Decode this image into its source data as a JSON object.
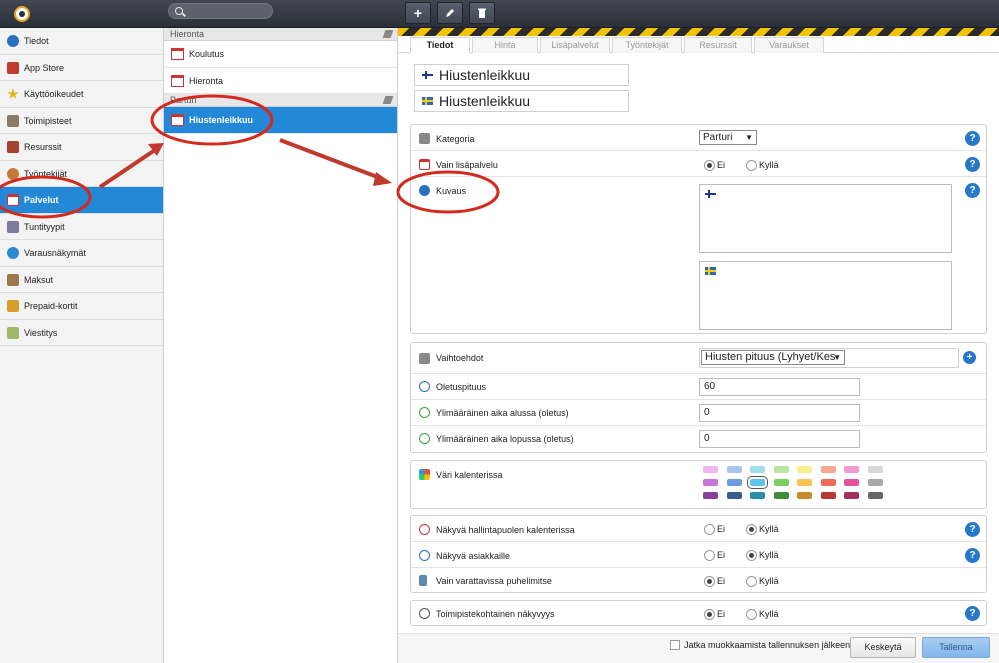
{
  "topbar": {
    "search_placeholder": "",
    "add_label": "+",
    "edit_icon": "pencil-icon",
    "delete_icon": "trash-icon"
  },
  "sidebar": {
    "items": [
      {
        "label": "Tiedot",
        "icon": "info-icon",
        "color": "#2a6fc2"
      },
      {
        "label": "App Store",
        "icon": "store-icon",
        "color": "#c43a2e"
      },
      {
        "label": "Käyttöoikeudet",
        "icon": "star-icon",
        "color": "#e3b81c"
      },
      {
        "label": "Toimipisteet",
        "icon": "building-icon",
        "color": "#8a7b67"
      },
      {
        "label": "Resurssit",
        "icon": "house-icon",
        "color": "#a5432f"
      },
      {
        "label": "Työntekijät",
        "icon": "people-icon",
        "color": "#c47b3a"
      },
      {
        "label": "Palvelut",
        "icon": "calendar-icon",
        "color": "#c33"
      },
      {
        "label": "Tuntityypit",
        "icon": "calendar-grid-icon",
        "color": "#7a7a9a"
      },
      {
        "label": "Varausnäkymät",
        "icon": "globe-icon",
        "color": "#2a8bd4"
      },
      {
        "label": "Maksut",
        "icon": "wallet-icon",
        "color": "#9a7a4a"
      },
      {
        "label": "Prepaid-kortit",
        "icon": "card-icon",
        "color": "#d8a02a"
      },
      {
        "label": "Viestitys",
        "icon": "message-icon",
        "color": "#9fb86a"
      }
    ]
  },
  "services": {
    "groups": [
      {
        "name": "Hieronta",
        "items": [
          "Koulutus",
          "Hieronta"
        ]
      },
      {
        "name": "Parturi",
        "items": [
          "Hiustenleikkuu"
        ]
      }
    ]
  },
  "tabs": [
    "Tiedot",
    "Hinta",
    "Lisäpalvelut",
    "Työntekijät",
    "Resurssit",
    "Varaukset"
  ],
  "names": {
    "fi": "Hiustenleikkuu",
    "se": "Hiustenleikkuu"
  },
  "form": {
    "kategoria_label": "Kategoria",
    "kategoria_value": "Parturi",
    "vain_label": "Vain lisäpalvelu",
    "kuvaus_label": "Kuvaus",
    "ei": "Ei",
    "kylla": "Kyllä",
    "vaihtoehdot_label": "Vaihtoehdot",
    "vaihtoehdot_value": "Hiusten pituus (Lyhyet/Kes",
    "oletus_label": "Oletuspituus",
    "oletus_value": "60",
    "alussa_label": "Ylimääräinen aika alussa (oletus)",
    "alussa_value": "0",
    "lopussa_label": "Ylimääräinen aika lopussa (oletus)",
    "lopussa_value": "0",
    "vari_label": "Väri kalenterissa",
    "nakyva_hallinta_label": "Näkyvä hallintapuolen kalenterissa",
    "nakyva_asiakas_label": "Näkyvä asiakkaille",
    "puhelin_label": "Vain varattavissa puhelimitse",
    "toimipiste_label": "Toimipistekohtainen näkyvyys"
  },
  "colors": {
    "rows": [
      [
        "#f0b6f0",
        "#a8c7e8",
        "#9fe0e8",
        "#b9e6a0",
        "#f7ef8e",
        "#f6a88f",
        "#f29ad0",
        "#d8d8d8"
      ],
      [
        "#c676d8",
        "#6f9be0",
        "#5bc6e8",
        "#79cf5f",
        "#f6c451",
        "#f06a5a",
        "#e8529e",
        "#a8a8a8"
      ],
      [
        "#8a3f9a",
        "#3a5f8f",
        "#2a8fa8",
        "#3f8f3a",
        "#c98a2a",
        "#b53a2f",
        "#a3305f",
        "#666666"
      ]
    ],
    "selected": "#5bc6e8"
  },
  "footer": {
    "continue_label": "Jatka muokkaamista tallennuksen jälkeen",
    "cancel_label": "Keskeytä",
    "save_label": "Tallenna"
  }
}
